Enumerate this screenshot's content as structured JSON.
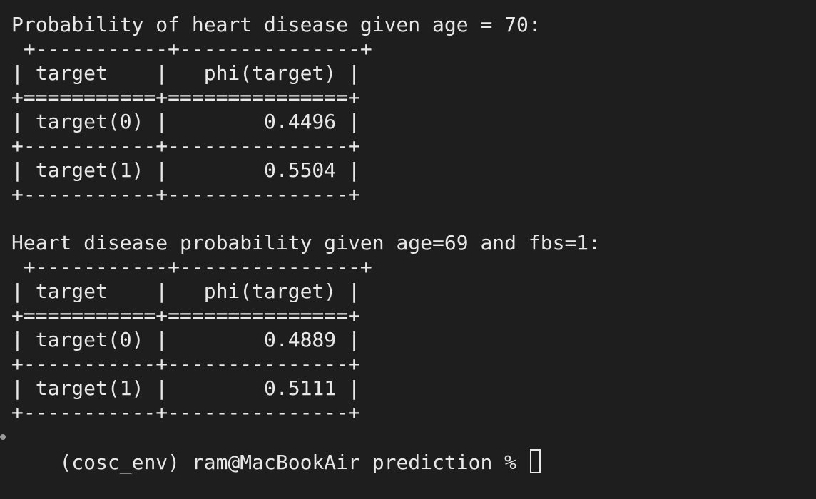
{
  "terminal": {
    "lines": [
      "Probability of heart disease given age = 70:",
      " +-----------+---------------+",
      "| target    |   phi(target) |",
      "+===========+===============+",
      "| target(0) |        0.4496 |",
      "+-----------+---------------+",
      "| target(1) |        0.5504 |",
      "+-----------+---------------+",
      "",
      "Heart disease probability given age=69 and fbs=1:",
      " +-----------+---------------+",
      "| target    |   phi(target) |",
      "+===========+===============+",
      "| target(0) |        0.4889 |",
      "+-----------+---------------+",
      "| target(1) |        0.5111 |",
      "+-----------+---------------+"
    ],
    "prompt": "(cosc_env) ram@MacBookAir prediction % "
  }
}
